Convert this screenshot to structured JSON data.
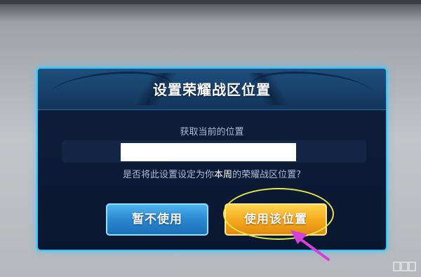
{
  "dialog": {
    "title": "设置荣耀战区位置",
    "sub_label": "获取当前的位置",
    "location_value": "",
    "question_prefix": "是否将此设置设定为你",
    "question_emphasis": "本周",
    "question_suffix": "的荣耀战区位置?"
  },
  "buttons": {
    "cancel_label": "暂不使用",
    "confirm_label": "使用该位置"
  },
  "annotation": {
    "ellipse_color": "#e6e84a",
    "arrow_color": "#d63fd9"
  },
  "colors": {
    "dialog_border": "#2ec4ff",
    "dialog_bg": "#0b1a33",
    "button_blue": "#2a87cf",
    "button_gold": "#f5a81c"
  }
}
